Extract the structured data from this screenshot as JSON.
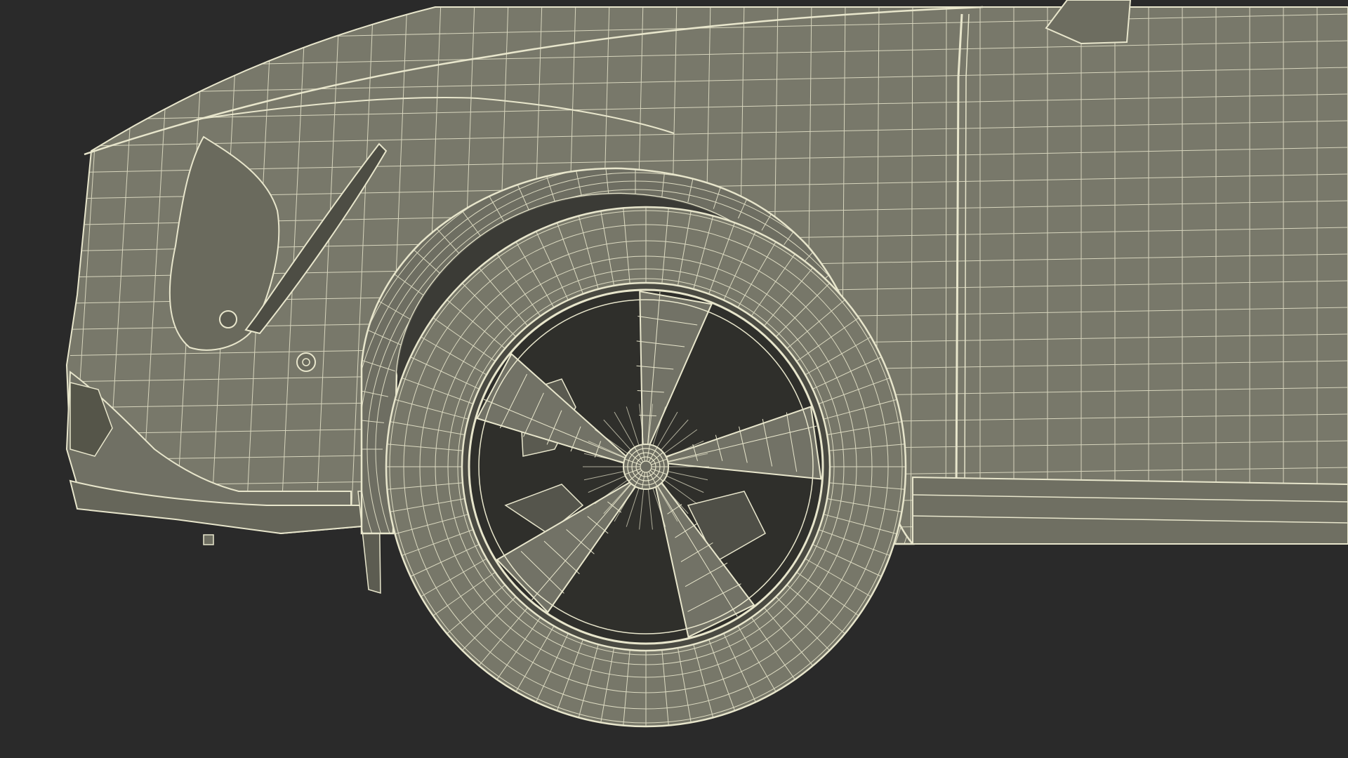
{
  "scene": {
    "subject": "car-front-wheel-wireframe",
    "colors": {
      "background": "#2a2a2a",
      "surface": "#78786a",
      "surface_dark": "#5f5f55",
      "surface_shadow": "#3e3e38",
      "wire": "#e8e6cc",
      "wire_faint": "#d6d4b8"
    }
  }
}
